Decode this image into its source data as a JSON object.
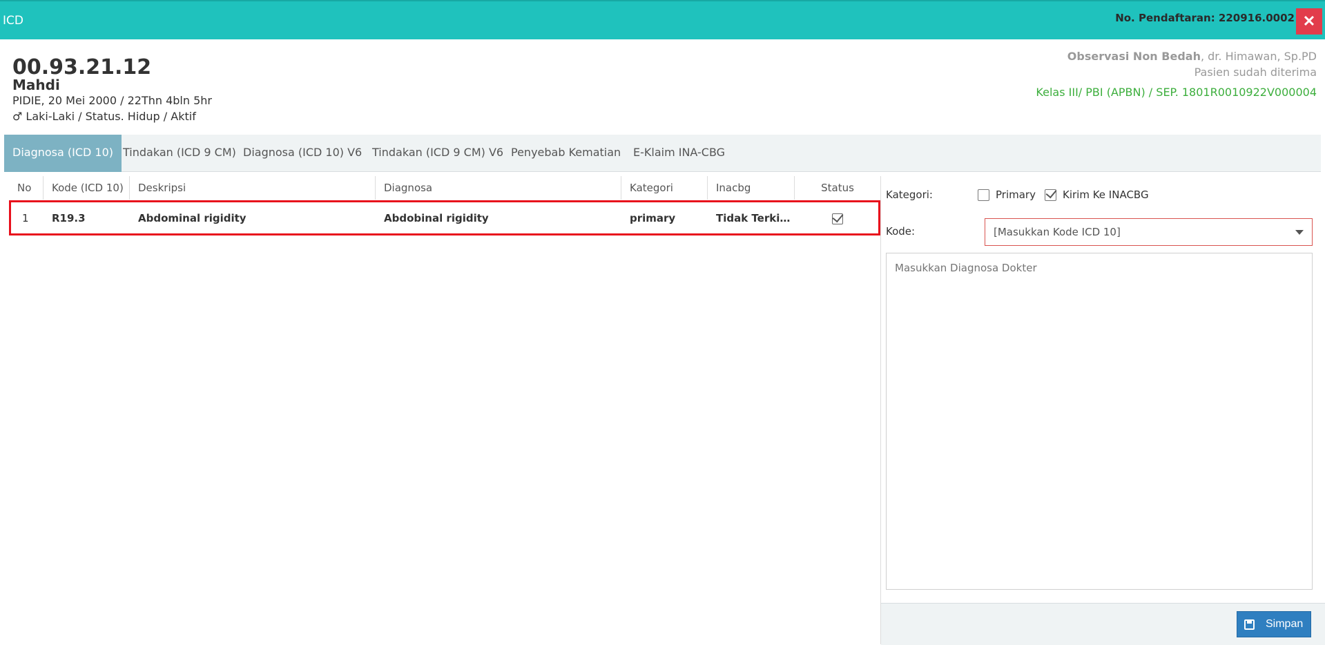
{
  "header": {
    "title": "ICD",
    "registration": "No. Pendaftaran: 220916.0002",
    "close_icon": "times-icon"
  },
  "patient": {
    "id": "00.93.21.12",
    "name": "Mahdi",
    "birth": "PIDIE, 20 Mei 2000 / 22Thn 4bln 5hr",
    "status": "♂ Laki-Laki / Status. Hidup / Aktif"
  },
  "visit": {
    "unit": "Observasi Non Bedah",
    "doctor": ", dr. Himawan, Sp.PD",
    "status": "Pasien sudah diterima",
    "kelas": "Kelas III/ PBI (APBN) / SEP. 1801R0010922V000004"
  },
  "tabs": [
    {
      "label": "Diagnosa (ICD 10)",
      "active": true
    },
    {
      "label": "Tindakan (ICD 9 CM)"
    },
    {
      "label": "Diagnosa (ICD 10) V6"
    },
    {
      "label": "Tindakan (ICD 9 CM) V6"
    },
    {
      "label": "Penyebab Kematian"
    },
    {
      "label": "E-Klaim INA-CBG"
    }
  ],
  "table": {
    "columns": [
      "No",
      "Kode (ICD 10)",
      "Deskripsi",
      "Diagnosa",
      "Kategori",
      "Inacbg",
      "Status"
    ],
    "rows": [
      {
        "no": "1",
        "kode": "R19.3",
        "deskripsi": "Abdominal rigidity",
        "diagnosa": "Abdobinal rigidity",
        "kategori": "primary",
        "inacbg": "Tidak Terkir...",
        "status_icon": "check-square-icon"
      }
    ]
  },
  "form": {
    "kategori_label": "Kategori:",
    "primary_label": "Primary",
    "primary_checked": false,
    "kirim_label": "Kirim Ke INACBG",
    "kirim_checked": true,
    "kode_label": "Kode:",
    "kode_placeholder": "[Masukkan Kode ICD 10]",
    "diagnosa_placeholder": "Masukkan Diagnosa Dokter",
    "save_label": "Simpan",
    "save_icon": "floppy-disk-icon"
  },
  "colors": {
    "topbar": "#1fc2bd",
    "active_tab": "#7db2c3",
    "highlight": "#e8101c",
    "close": "#e23c4b",
    "save": "#2f7fc0",
    "kelas": "#3cae3c"
  }
}
